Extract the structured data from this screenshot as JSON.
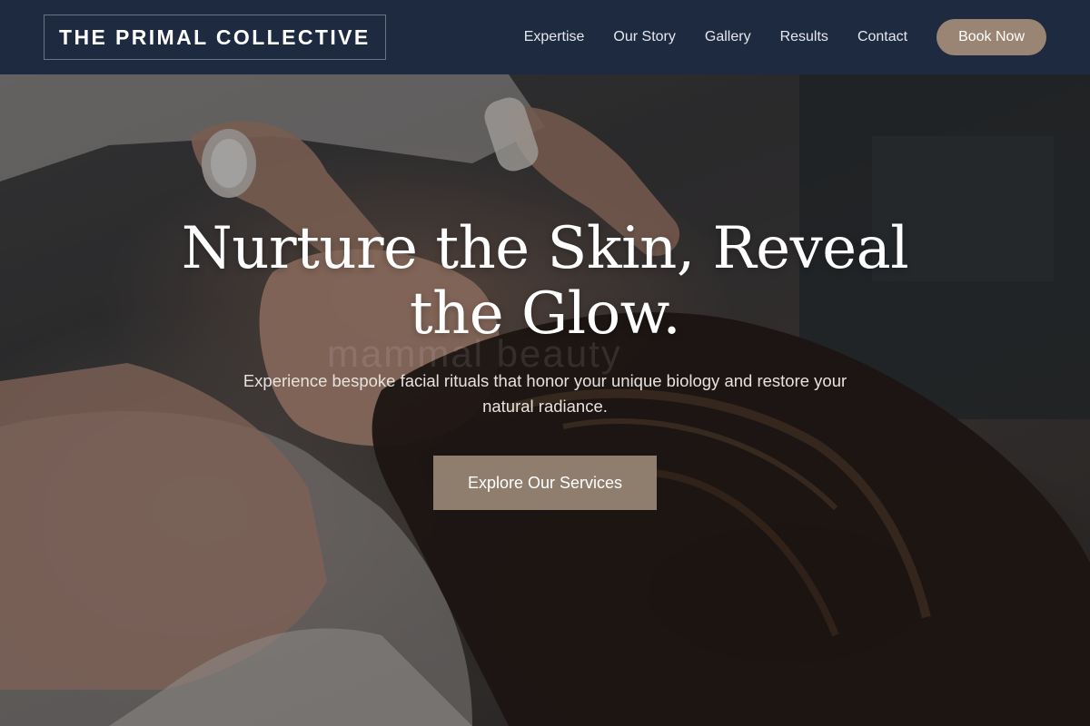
{
  "header": {
    "logo_text": "THE PRIMAL COLLECTIVE",
    "nav": [
      {
        "label": "Expertise"
      },
      {
        "label": "Our Story"
      },
      {
        "label": "Gallery"
      },
      {
        "label": "Results"
      },
      {
        "label": "Contact"
      }
    ],
    "book_button_label": "Book Now"
  },
  "hero": {
    "title_line_1": "Nurture the Skin, Reveal",
    "title_line_2": "the Glow.",
    "subtitle": "Experience bespoke facial rituals that honor your unique biology and restore your natural radiance.",
    "cta_label": "Explore Our Services",
    "watermark": "mammal beauty"
  },
  "colors": {
    "header_bg": "#1d2a40",
    "accent": "#9a8574",
    "cta_bg": "#8f7e6d",
    "text_light": "#ffffff"
  },
  "icons": [
    "hero-photo"
  ]
}
